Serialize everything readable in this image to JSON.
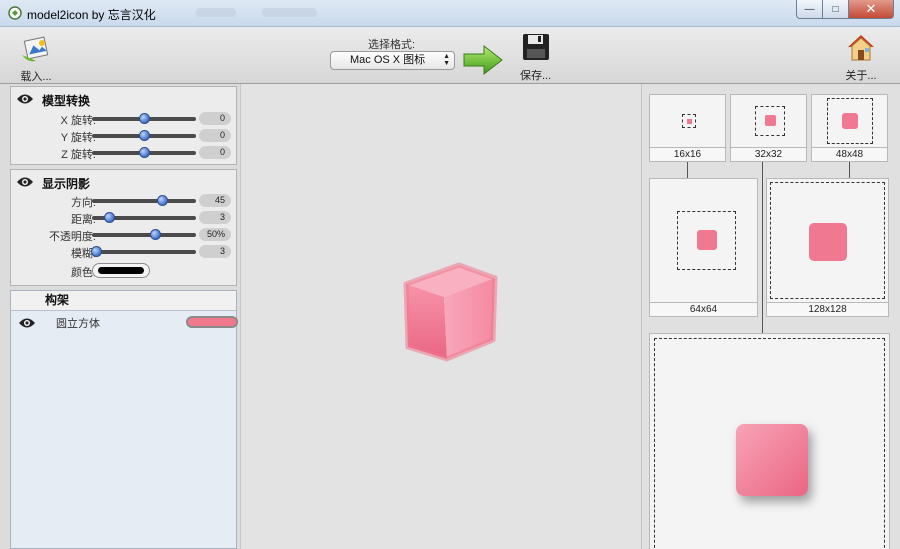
{
  "window": {
    "title": "model2icon by 忘言汉化",
    "buttons": {
      "minimize": "—",
      "maximize": "□",
      "close": "✕"
    }
  },
  "toolbar": {
    "load_label": "载入...",
    "format_title": "选择格式:",
    "format_selected": "Mac OS X 图标",
    "save_label": "保存...",
    "about_label": "关于..."
  },
  "transform": {
    "title": "模型转换",
    "rows": [
      {
        "label": "X 旋转:",
        "value": "0",
        "level": 0.5
      },
      {
        "label": "Y 旋转:",
        "value": "0",
        "level": 0.5
      },
      {
        "label": "Z 旋转:",
        "value": "0",
        "level": 0.5
      }
    ]
  },
  "shadow": {
    "title": "显示阴影",
    "rows": [
      {
        "label": "方向:",
        "value": "45",
        "level": 0.67
      },
      {
        "label": "距离:",
        "value": "3",
        "level": 0.16
      },
      {
        "label": "不透明度:",
        "value": "50%",
        "level": 0.61
      },
      {
        "label": "模糊:",
        "value": "3",
        "level": 0.04
      }
    ],
    "color_label": "颜色:",
    "color_value": "#000000"
  },
  "tree": {
    "title": "构架",
    "items": [
      {
        "name": "圆立方体",
        "color": "#f0788c"
      }
    ]
  },
  "model": {
    "color": "#f07890"
  },
  "previews": [
    {
      "size": "16x16"
    },
    {
      "size": "32x32"
    },
    {
      "size": "48x48"
    },
    {
      "size": "64x64"
    },
    {
      "size": "128x128"
    }
  ]
}
